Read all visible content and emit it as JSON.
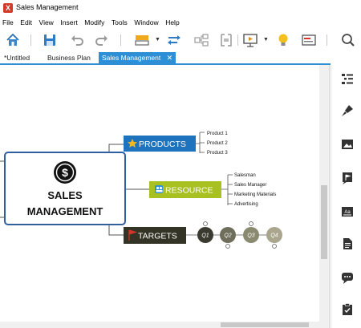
{
  "window": {
    "title": "Sales Management",
    "app_icon_glyph": "X"
  },
  "menu": [
    "File",
    "Edit",
    "View",
    "Insert",
    "Modify",
    "Tools",
    "Window",
    "Help"
  ],
  "toolbar": {
    "icons": [
      "home-icon",
      "save-icon",
      "undo-icon",
      "redo-icon",
      "topic-style-icon",
      "relationship-icon",
      "subtopic-icon",
      "boundary-icon",
      "presentation-icon",
      "idea-icon",
      "slides-icon",
      "search-icon"
    ]
  },
  "tabs": [
    {
      "label": "*Untitled",
      "active": false
    },
    {
      "label": "Business Plan",
      "active": false
    },
    {
      "label": "Sales Management",
      "active": true,
      "close": "✕"
    }
  ],
  "mindmap": {
    "central": {
      "line1": "SALES",
      "line2": "MANAGEMENT",
      "icon": "dollar-icon"
    },
    "branches": [
      {
        "label": "PRODUCTS",
        "icon": "star-icon",
        "color": "#1e73be",
        "children": [
          "Product 1",
          "Product 2",
          "Product 3"
        ]
      },
      {
        "label": "RESOURCE",
        "icon": "people-icon",
        "color": "#a8c020",
        "children": [
          "Salesman",
          "Sales Manager",
          "Marketing Materials",
          "Advertising"
        ]
      },
      {
        "label": "TARGETS",
        "icon": "flag-icon",
        "color": "#333326",
        "children": [
          "Q1",
          "Q2",
          "Q3",
          "Q4"
        ]
      }
    ]
  },
  "right_panel": {
    "icons": [
      "outline-icon",
      "format-brush-icon",
      "image-icon",
      "marker-flag-icon",
      "text-icon",
      "notes-icon",
      "comment-icon",
      "task-icon"
    ]
  },
  "colors": {
    "accent": "#2d8fd5",
    "central_border": "#2f5f9e"
  }
}
